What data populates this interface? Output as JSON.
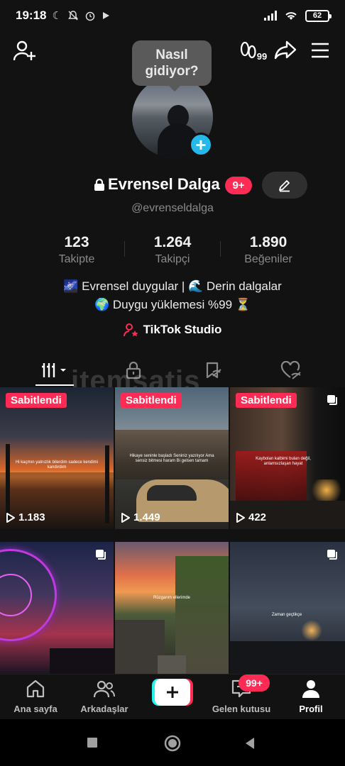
{
  "status_bar": {
    "time": "19:18",
    "battery": "62"
  },
  "top_bar": {
    "add_friend_icon": "person-plus-icon",
    "activity_count": "99",
    "share_icon": "share-arrow-icon",
    "menu_icon": "hamburger-menu-icon"
  },
  "profile": {
    "bubble_text": "Nasıl gidiyor?",
    "display_name": "Evrensel Dalga",
    "notification_badge": "9+",
    "handle": "@evrenseldalga",
    "stats": [
      {
        "value": "123",
        "label": "Takipte"
      },
      {
        "value": "1.264",
        "label": "Takipçi"
      },
      {
        "value": "1.890",
        "label": "Beğeniler"
      }
    ],
    "bio_line1": "🌌 Evrensel duygular | 🌊 Derin dalgalar",
    "bio_line2": "🌍 Duygu yüklemesi %99 ⏳",
    "studio_label": "TikTok Studio"
  },
  "watermark": "itemsatis",
  "grid": {
    "pinned_label": "Sabitlendi",
    "videos": [
      {
        "pinned": true,
        "views": "1.183",
        "caption": "Hi kaçmın yalnızlık bilerdim sadece kendimi kandırdım"
      },
      {
        "pinned": true,
        "views": "1.449",
        "caption": "Hikaye seninle başladı Seniniz yazılıyor Ama sensiz bitmesi haram Bi gelsen tamam"
      },
      {
        "pinned": true,
        "views": "422",
        "caption": "Kaybolan kalbimi bulan değil, anlamsızlaşan hayat"
      },
      {
        "pinned": false,
        "views": "",
        "caption": ""
      },
      {
        "pinned": false,
        "views": "",
        "caption": "Rüzgarım ellerimde"
      },
      {
        "pinned": false,
        "views": "",
        "caption": "Zaman geçtikçe"
      }
    ]
  },
  "bottom_nav": {
    "home": "Ana sayfa",
    "friends": "Arkadaşlar",
    "inbox": "Gelen kutusu",
    "inbox_badge": "99+",
    "profile": "Profil"
  },
  "colors": {
    "accent": "#fe2c55",
    "blue": "#25b8e8",
    "background": "#121212"
  }
}
